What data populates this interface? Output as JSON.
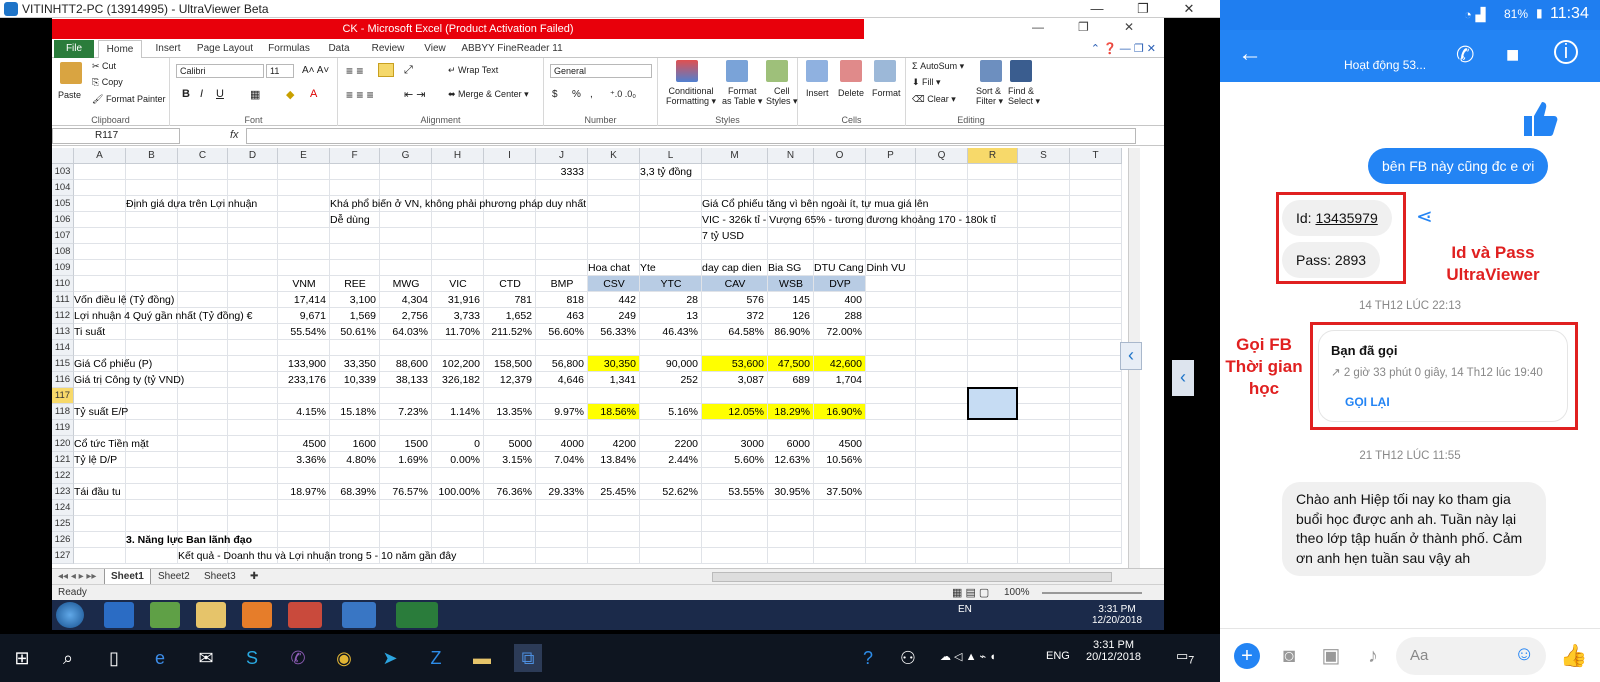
{
  "uv": {
    "title": "VITINHTT2-PC (13914995) - UltraViewer Beta",
    "minimize": "—",
    "maximize": "❐",
    "close": "✕"
  },
  "excel": {
    "title": "CK - Microsoft Excel (Product Activation Failed)",
    "tabs": [
      "File",
      "Home",
      "Insert",
      "Page Layout",
      "Formulas",
      "Data",
      "Review",
      "View",
      "ABBYY FineReader 11"
    ],
    "ribbon": {
      "paste": "Paste",
      "cut": "Cut",
      "copy": "Copy",
      "format_painter": "Format Painter",
      "clipboard": "Clipboard",
      "font_name": "Calibri",
      "font_size": "11",
      "font": "Font",
      "bold": "B",
      "italic": "I",
      "underline": "U",
      "wrap_text": "Wrap Text",
      "merge_center": "Merge & Center",
      "alignment": "Alignment",
      "number_format": "General",
      "number": "Number",
      "currency": "$",
      "percent": "%",
      "comma": ",",
      "cond_formatting_1": "Conditional",
      "cond_formatting_2": "Formatting",
      "format_table_1": "Format",
      "format_table_2": "as Table",
      "cell_styles_1": "Cell",
      "cell_styles_2": "Styles",
      "styles": "Styles",
      "insert": "Insert",
      "delete": "Delete",
      "format": "Format",
      "cells": "Cells",
      "autosum": "AutoSum",
      "fill": "Fill",
      "clear": "Clear",
      "sort_filter_1": "Sort &",
      "sort_filter_2": "Filter",
      "find_select_1": "Find &",
      "find_select_2": "Select",
      "editing": "Editing"
    },
    "name_box": "R117",
    "fx": "fx",
    "columns": [
      "A",
      "B",
      "C",
      "D",
      "E",
      "F",
      "G",
      "H",
      "I",
      "J",
      "K",
      "L",
      "M",
      "N",
      "O",
      "P",
      "Q",
      "R",
      "S",
      "T"
    ],
    "rows": [
      "103",
      "104",
      "105",
      "106",
      "107",
      "108",
      "109",
      "110",
      "111",
      "112",
      "113",
      "114",
      "115",
      "116",
      "117",
      "118",
      "119",
      "120",
      "121",
      "122",
      "123",
      "124",
      "125",
      "126",
      "127"
    ],
    "cells": {
      "r103_j": "3333",
      "r103_l": "3,3 tỷ đồng",
      "r105_b": "Định giá dựa trên Lợi nhuận",
      "r105_f": "Khá phổ biến ở VN, không phải phương pháp duy nhất",
      "r105_m": "Giá Cổ phiếu tăng vì bên ngoài ít, tự mua giá lên",
      "r106_f": "Dễ dùng",
      "r106_m": "VIC - 326k tỉ - Vượng 65% - tương đương khoảng 170 - 180k tỉ",
      "r107_m": "7 tỷ USD",
      "r109_k": "Hoa chat",
      "r109_l": "Yte",
      "r109_m": "day cap dien",
      "r109_n": "Bia SG",
      "r109_o": "DTU Cang Dinh VU"
    },
    "tickers": [
      "VNM",
      "REE",
      "MWG",
      "VIC",
      "CTD",
      "BMP",
      "CSV",
      "YTC",
      "CAV",
      "WSB",
      "DVP"
    ],
    "table_rows": [
      {
        "row": "111",
        "label": "Vốn điều lệ (Tỷ đồng)",
        "values": [
          "17,414",
          "3,100",
          "4,304",
          "31,916",
          "781",
          "818",
          "442",
          "28",
          "576",
          "145",
          "400"
        ]
      },
      {
        "row": "112",
        "label": "Lợi nhuận 4 Quý gần nhất (Tỷ đồng) €",
        "values": [
          "9,671",
          "1,569",
          "2,756",
          "3,733",
          "1,652",
          "463",
          "249",
          "13",
          "372",
          "126",
          "288"
        ]
      },
      {
        "row": "113",
        "label": "Ti suất",
        "values": [
          "55.54%",
          "50.61%",
          "64.03%",
          "11.70%",
          "211.52%",
          "56.60%",
          "56.33%",
          "46.43%",
          "64.58%",
          "86.90%",
          "72.00%"
        ]
      },
      {
        "row": "115",
        "label": "Giá Cổ phiếu (P)",
        "values": [
          "133,900",
          "33,350",
          "88,600",
          "102,200",
          "158,500",
          "56,800",
          "30,350",
          "90,000",
          "53,600",
          "47,500",
          "42,600"
        ]
      },
      {
        "row": "116",
        "label": "Giá trị Công ty (tỷ VND)",
        "values": [
          "233,176",
          "10,339",
          "38,133",
          "326,182",
          "12,379",
          "4,646",
          "1,341",
          "252",
          "3,087",
          "689",
          "1,704"
        ]
      },
      {
        "row": "118",
        "label": "Tỷ suất E/P",
        "values": [
          "4.15%",
          "15.18%",
          "7.23%",
          "1.14%",
          "13.35%",
          "9.97%",
          "18.56%",
          "5.16%",
          "12.05%",
          "18.29%",
          "16.90%"
        ]
      },
      {
        "row": "120",
        "label": "Cổ tức Tiền mặt",
        "values": [
          "4500",
          "1600",
          "1500",
          "0",
          "5000",
          "4000",
          "4200",
          "2200",
          "3000",
          "6000",
          "4500"
        ]
      },
      {
        "row": "121",
        "label": "Tỷ lệ D/P",
        "values": [
          "3.36%",
          "4.80%",
          "1.69%",
          "0.00%",
          "3.15%",
          "7.04%",
          "13.84%",
          "2.44%",
          "5.60%",
          "12.63%",
          "10.56%"
        ]
      },
      {
        "row": "123",
        "label": "Tái đầu tu",
        "values": [
          "18.97%",
          "68.39%",
          "76.57%",
          "100.00%",
          "76.36%",
          "29.33%",
          "25.45%",
          "52.62%",
          "53.55%",
          "30.95%",
          "37.50%"
        ]
      }
    ],
    "r126_b": "3. Năng lực Ban lãnh đạo",
    "r127_c": "Kết quả - Doanh thu và Lợi nhuận trong 5 - 10 năm gần đây",
    "sheets": [
      "Sheet1",
      "Sheet2",
      "Sheet3"
    ],
    "status": "Ready",
    "zoom": "100%",
    "remote_clock_time": "3:31 PM",
    "remote_clock_date": "12/20/2018",
    "remote_lang": "EN"
  },
  "local_taskbar": {
    "time": "3:31 PM",
    "date": "20/12/2018",
    "lang": "ENG",
    "notif_count": "7"
  },
  "phone": {
    "status_battery": "81%",
    "status_time": "11:34",
    "chat_title": "Hoạt động 53...",
    "msg_out": "bên FB này cũng đc e ơi",
    "id_label": "Id: ",
    "id_value": "13435979",
    "pass_text": "Pass: 2893",
    "annot_id_1": "Id và Pass",
    "annot_id_2": "UltraViewer",
    "ts1": "14 TH12 LÚC 22:13",
    "annot_call": "Gọi FB Thời gian học",
    "call_title": "Bạn đã gọi",
    "call_detail": "↗ 2 giờ 33 phút 0 giây, 14 Th12 lúc 19:40",
    "call_back": "GỌI LẠI",
    "ts2": "21 TH12 LÚC 11:55",
    "msg_in": "Chào anh Hiệp tối nay ko tham gia buổi học được anh ah. Tuần này lại theo lớp tập huấn ở thành phố. Cảm ơn anh hẹn tuần sau vậy ah",
    "input_placeholder": "Aa"
  },
  "colors": {
    "excel_green": "#2a7c3b",
    "excel_red_title": "#e8000b",
    "messenger_blue": "#2384f4",
    "highlight_yellow": "#ffff00",
    "header_blue": "#b8cce4",
    "annotation_red": "#e02020"
  }
}
